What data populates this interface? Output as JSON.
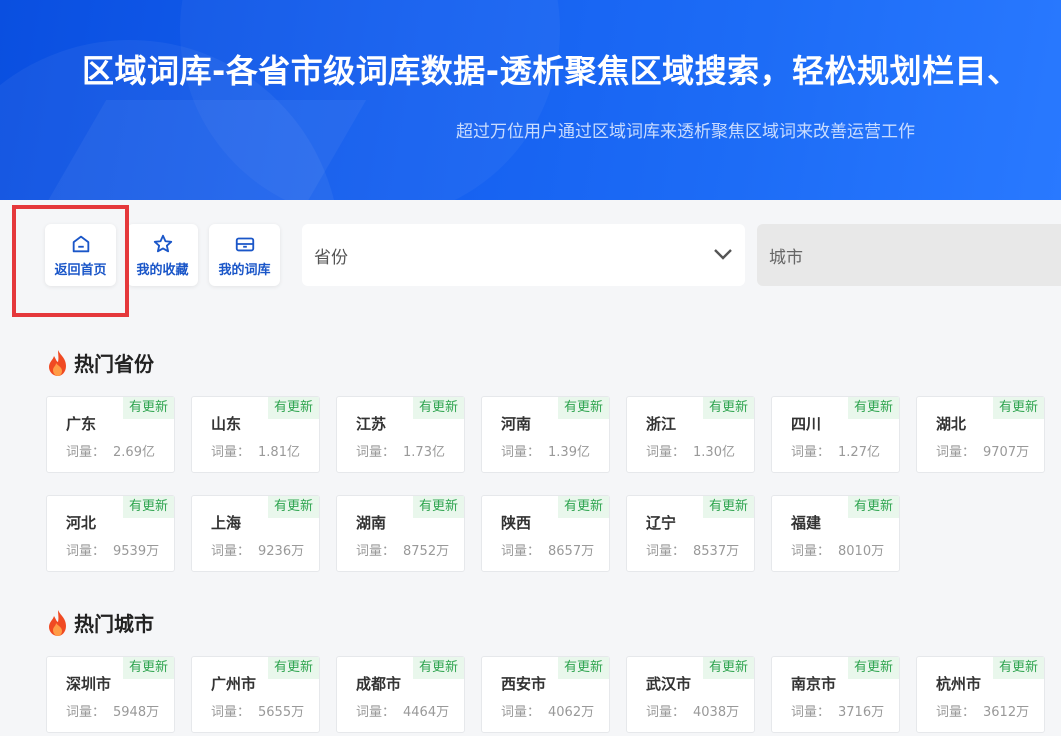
{
  "banner": {
    "title": "区域词库-各省市级词库数据-透析聚焦区域搜索，轻松规划栏目、",
    "subtitle": "超过万位用户通过区域词库来透析聚焦区域词来改善运营工作"
  },
  "toolbar": {
    "home_label": "返回首页",
    "favorites_label": "我的收藏",
    "library_label": "我的词库",
    "province_placeholder": "省份",
    "city_placeholder": "城市"
  },
  "volume_label": "词量：",
  "badge_text": "有更新",
  "hot_provinces": {
    "title": "热门省份",
    "items": [
      {
        "name": "广东",
        "volume": "2.69亿"
      },
      {
        "name": "山东",
        "volume": "1.81亿"
      },
      {
        "name": "江苏",
        "volume": "1.73亿"
      },
      {
        "name": "河南",
        "volume": "1.39亿"
      },
      {
        "name": "浙江",
        "volume": "1.30亿"
      },
      {
        "name": "四川",
        "volume": "1.27亿"
      },
      {
        "name": "湖北",
        "volume": "9707万"
      },
      {
        "name": "河北",
        "volume": "9539万"
      },
      {
        "name": "上海",
        "volume": "9236万"
      },
      {
        "name": "湖南",
        "volume": "8752万"
      },
      {
        "name": "陕西",
        "volume": "8657万"
      },
      {
        "name": "辽宁",
        "volume": "8537万"
      },
      {
        "name": "福建",
        "volume": "8010万"
      }
    ]
  },
  "hot_cities": {
    "title": "热门城市",
    "items": [
      {
        "name": "深圳市",
        "volume": "5948万"
      },
      {
        "name": "广州市",
        "volume": "5655万"
      },
      {
        "name": "成都市",
        "volume": "4464万"
      },
      {
        "name": "西安市",
        "volume": "4062万"
      },
      {
        "name": "武汉市",
        "volume": "4038万"
      },
      {
        "name": "南京市",
        "volume": "3716万"
      },
      {
        "name": "杭州市",
        "volume": "3612万"
      }
    ]
  },
  "colors": {
    "banner_blue": "#1560f0",
    "accent_blue": "#1a56c8",
    "badge_green": "#2ea44f",
    "highlight_red": "#e5383b"
  }
}
